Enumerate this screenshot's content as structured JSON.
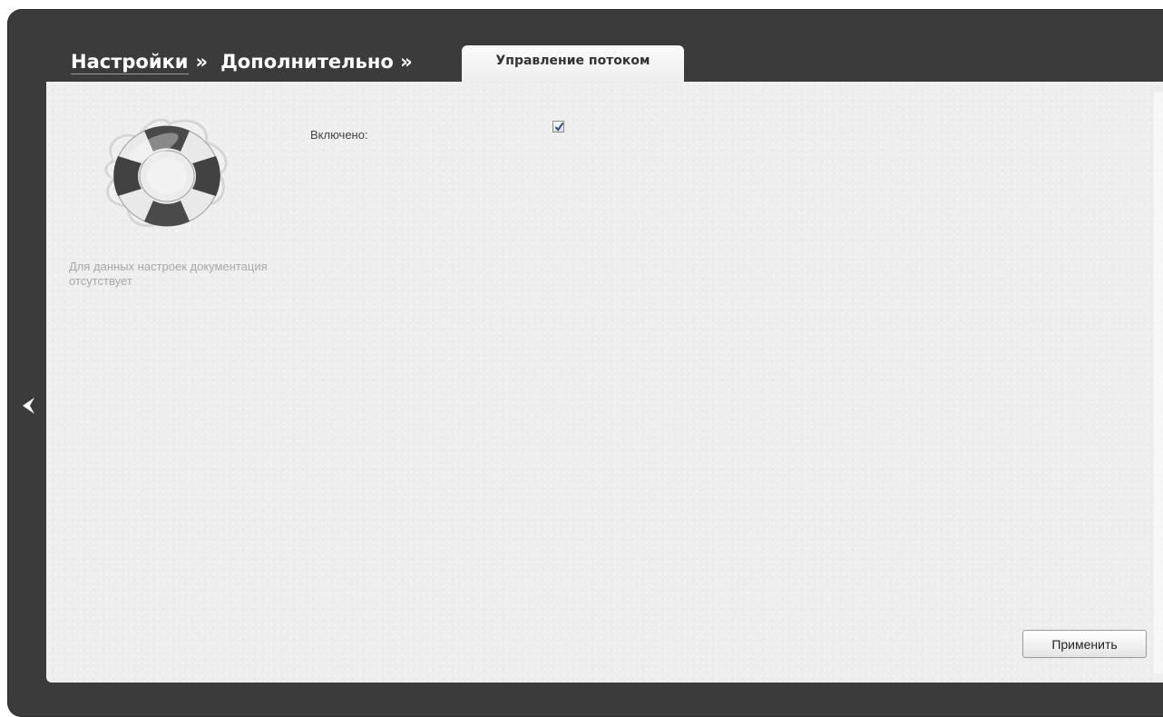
{
  "breadcrumb": {
    "item1": "Настройки",
    "sep1": "»",
    "item2": "Дополнительно »"
  },
  "active_tab": {
    "label": "Управление потоком"
  },
  "help": {
    "icon": "lifebuoy-icon",
    "text": "Для данных настроек документация отсутствует"
  },
  "form": {
    "enabled_label": "Включено:",
    "enabled_checked": true
  },
  "buttons": {
    "apply_label": "Применить"
  },
  "nav": {
    "back_icon": "chevron-left-icon"
  },
  "colors": {
    "frame": "#3b3b3b",
    "panel": "#eeeeee",
    "check_mark": "#2a4b8d"
  }
}
